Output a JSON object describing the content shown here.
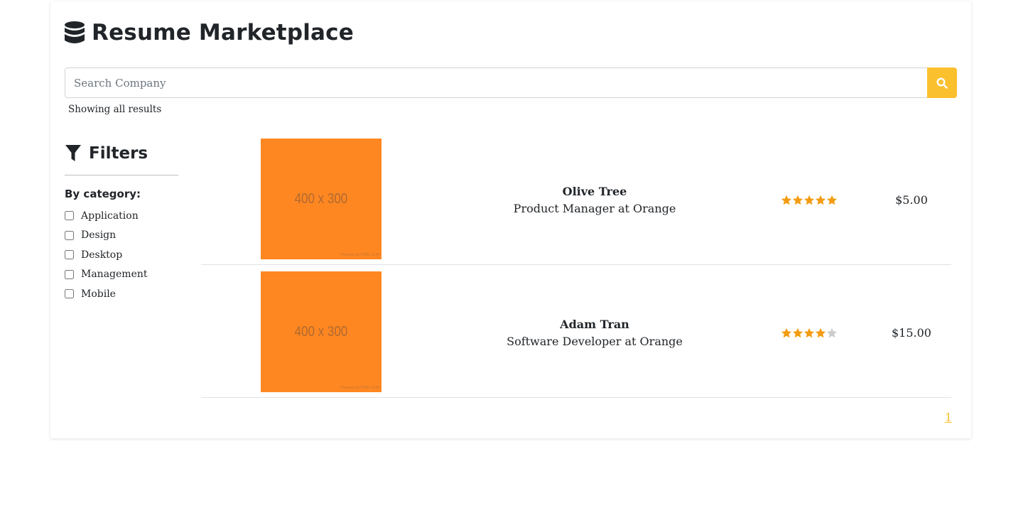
{
  "header": {
    "title": "Resume Marketplace",
    "icon": "database-icon"
  },
  "search": {
    "placeholder": "Search Company",
    "value": "",
    "button_icon": "search-icon"
  },
  "results_note": "Showing all results",
  "filters": {
    "title": "Filters",
    "icon": "filter-icon",
    "category_label": "By category:",
    "categories": [
      {
        "label": "Application",
        "checked": false
      },
      {
        "label": "Design",
        "checked": false
      },
      {
        "label": "Desktop",
        "checked": false
      },
      {
        "label": "Management",
        "checked": false
      },
      {
        "label": "Mobile",
        "checked": false
      }
    ]
  },
  "listings": [
    {
      "thumb_text": "400 x 300",
      "thumb_small": "Powered by HTML.COM",
      "name": "Olive Tree",
      "role": "Product Manager at Orange",
      "rating": 5,
      "price": "$5.00"
    },
    {
      "thumb_text": "400 x 300",
      "thumb_small": "Powered by HTML.COM",
      "name": "Adam Tran",
      "role": "Software Developer at Orange",
      "rating": 4,
      "price": "$15.00"
    }
  ],
  "pagination": {
    "current": "1"
  },
  "colors": {
    "accent": "#fbc02d",
    "star": "#f39c12",
    "star_empty": "#cccccc",
    "thumb": "#ff8722"
  }
}
